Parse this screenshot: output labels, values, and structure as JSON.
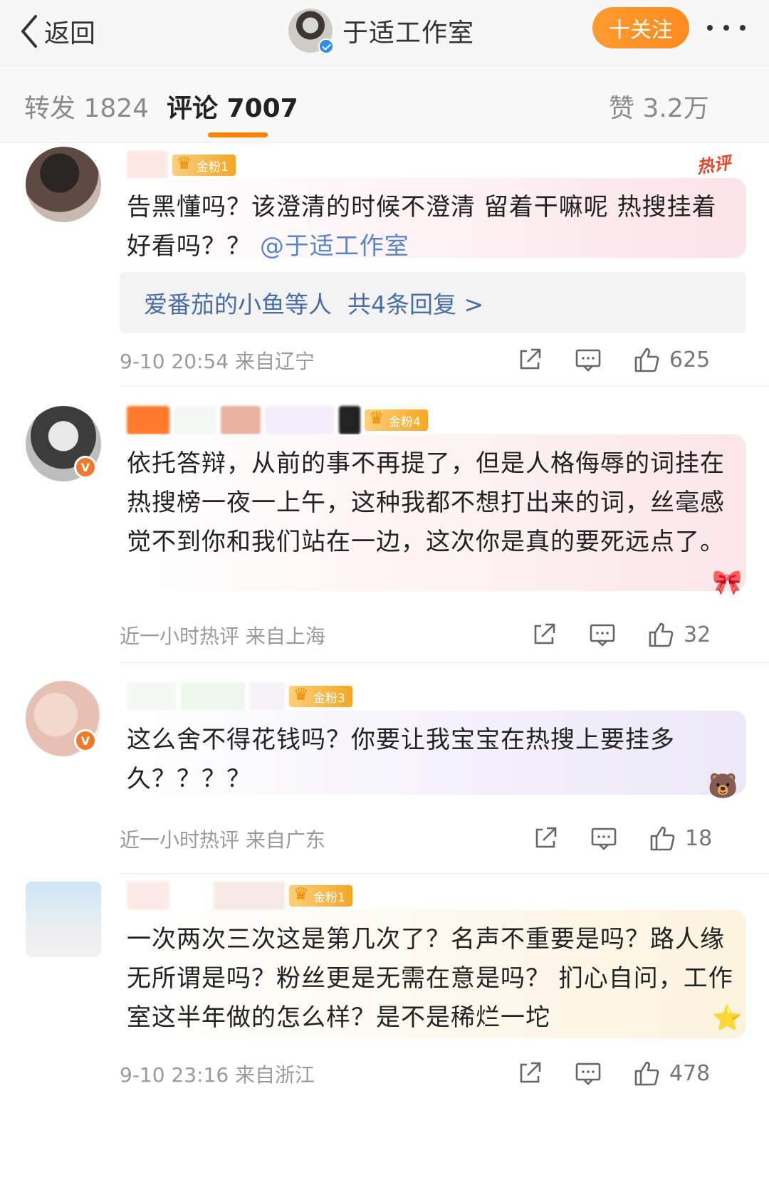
{
  "header": {
    "back_label": "返回",
    "title": "于适工作室",
    "follow_label": "十关注"
  },
  "tabs": {
    "repost": "转发 1824",
    "comments": "评论 7007",
    "likes": "赞 3.2万"
  },
  "comments": [
    {
      "fan_badge": "金粉1",
      "hot_tag": "热评",
      "text": "告黑懂吗？该澄清的时候不澄清 留着干嘛呢 热搜挂着好看吗？？",
      "mention": "@于适工作室",
      "reply_names": "爱番茄的小鱼等人",
      "reply_count": "共4条回复 >",
      "meta": "9-10 20:54  来自辽宁",
      "likes": "625"
    },
    {
      "fan_badge": "金粉4",
      "text": "依托答辩，从前的事不再提了，但是人格侮辱的词挂在热搜榜一夜一上午，这种我都不想打出来的词，丝毫感觉不到你和我们站在一边，这次你是真的要死远点了。",
      "meta": "近一小时热评  来自上海",
      "likes": "32"
    },
    {
      "fan_badge": "金粉3",
      "text": "这么舍不得花钱吗？你要让我宝宝在热搜上要挂多久？？？？",
      "meta": "近一小时热评  来自广东",
      "likes": "18"
    },
    {
      "fan_badge": "金粉1",
      "text": "一次两次三次这是第几次了？名声不重要是吗？路人缘无所谓是吗？粉丝更是无需在意是吗？ 扪心自问，工作室这半年做的怎么样？是不是稀烂一坨",
      "meta": "9-10 23:16  来自浙江",
      "likes": "478"
    }
  ],
  "colors": {
    "accent": "#ff8200",
    "follow_button": "#ff9b2f",
    "link": "#496da6",
    "hot_tag": "#e8452b"
  },
  "icons": [
    "back-chevron-icon",
    "verified-icon",
    "more-dots-icon",
    "share-icon",
    "comment-icon",
    "like-icon",
    "crown-icon"
  ]
}
